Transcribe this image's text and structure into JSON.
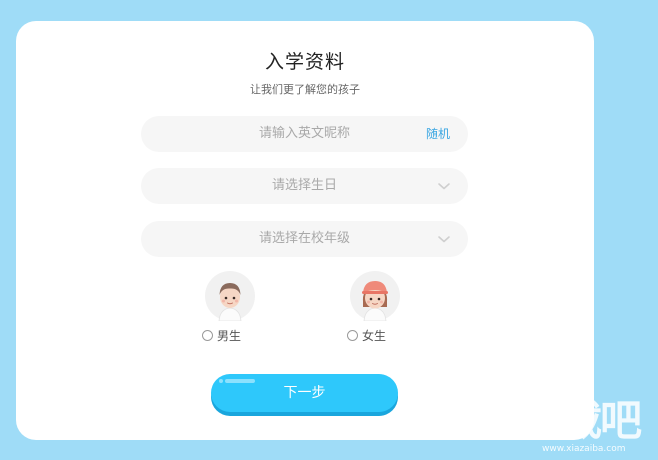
{
  "form": {
    "title": "入学资料",
    "subtitle": "让我们更了解您的孩子",
    "nickname_placeholder": "请输入英文昵称",
    "random_label": "随机",
    "birthday_placeholder": "请选择生日",
    "grade_placeholder": "请选择在校年级",
    "gender_options": [
      {
        "label": "男生",
        "icon": "boy-avatar-icon",
        "selected": false
      },
      {
        "label": "女生",
        "icon": "girl-avatar-icon",
        "selected": false
      }
    ],
    "next_label": "下一步"
  },
  "watermark": {
    "logo": "下载吧",
    "url": "www.xiazaiba.com"
  },
  "colors": {
    "background": "#9fdcf7",
    "card": "#ffffff",
    "field": "#f6f6f6",
    "accent": "#2ec8fb",
    "link": "#3aa6e2"
  }
}
